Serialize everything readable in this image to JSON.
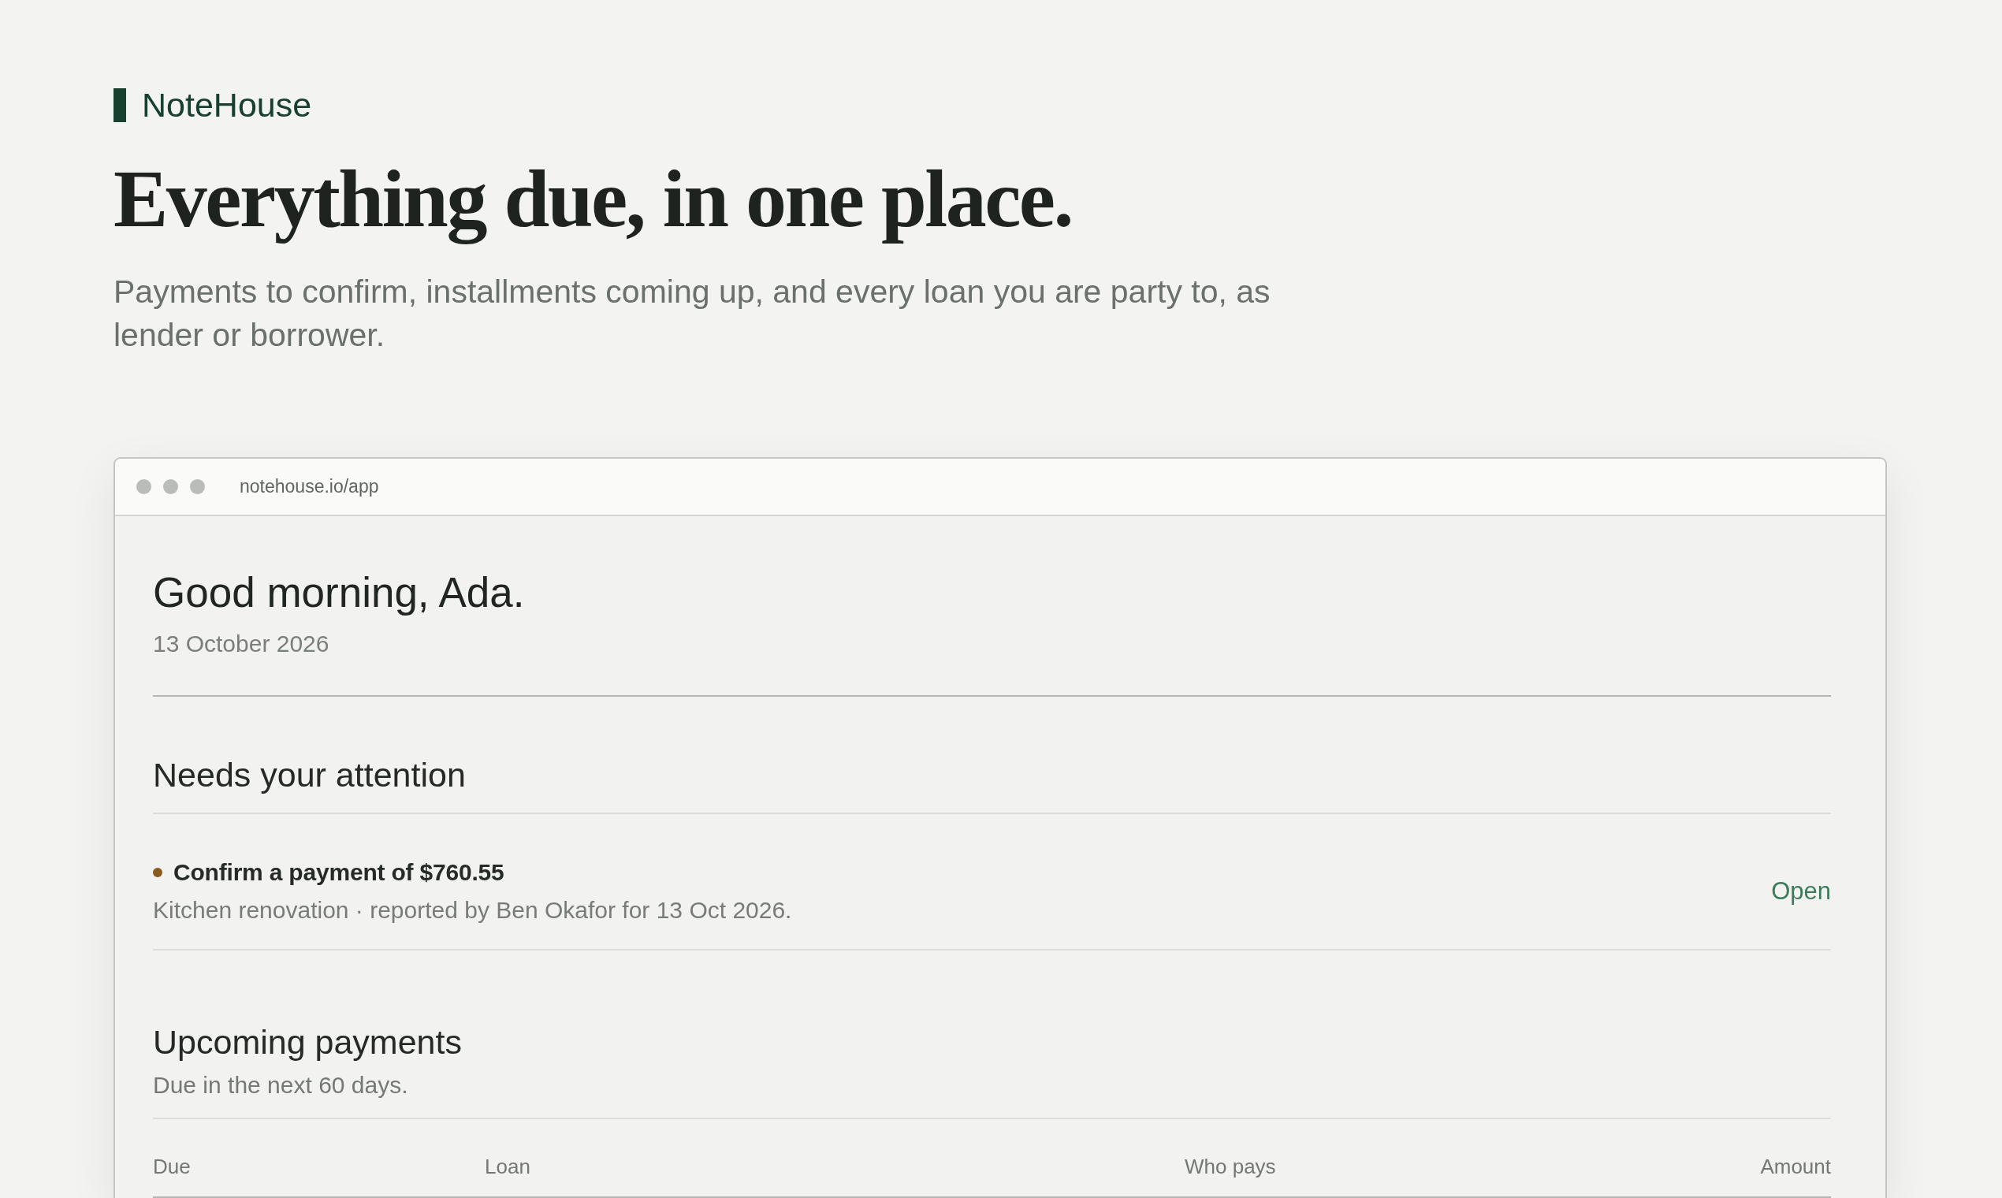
{
  "brand": {
    "name": "NoteHouse"
  },
  "hero": {
    "title": "Everything due, in one place.",
    "subtitle": "Payments to confirm, installments coming up, and every loan you are party to, as lender or borrower."
  },
  "browser_window": {
    "url": "notehouse.io/app"
  },
  "app": {
    "greeting": "Good morning, Ada.",
    "date": "13 October 2026",
    "attention": {
      "title": "Needs your attention",
      "items": [
        {
          "title": "Confirm a payment of $760.55",
          "detail": "Kitchen renovation · reported by Ben Okafor for 13 Oct 2026.",
          "action": "Open",
          "color": "#8a5a1e"
        }
      ]
    },
    "upcoming": {
      "title": "Upcoming payments",
      "subtitle": "Due in the next 60 days.",
      "table": {
        "columns": [
          "Due",
          "Loan",
          "Who pays",
          "Amount"
        ]
      }
    }
  }
}
